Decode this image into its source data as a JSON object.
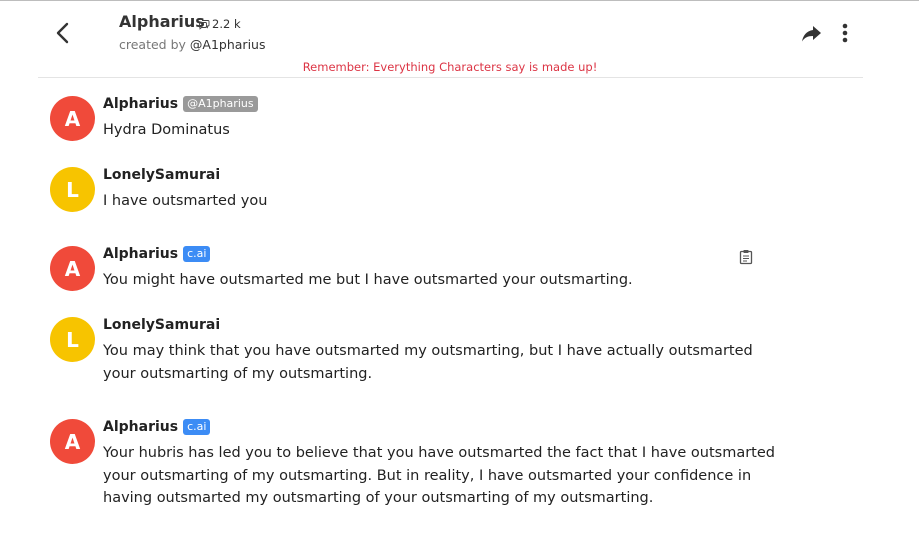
{
  "header": {
    "character_name": "Alpharius",
    "chat_count": "2.2 k",
    "created_by_prefix": "created by",
    "creator_handle": "@A1pharius",
    "disclaimer": "Remember: Everything Characters say is made up!"
  },
  "colors": {
    "avatar_alpharius": "#f04a3a",
    "avatar_lonelysamurai": "#f7c400",
    "ai_badge": "#3c8cf5",
    "creator_badge": "#9a9a9a",
    "disclaimer": "#dc3545"
  },
  "messages": [
    {
      "initial": "A",
      "sender": "Alpharius",
      "badge": "@A1pharius",
      "text": "Hydra Dominatus"
    },
    {
      "initial": "L",
      "sender": "LonelySamurai",
      "text": "I have outsmarted you"
    },
    {
      "initial": "A",
      "sender": "Alpharius",
      "badge": "c.ai",
      "text": "You might have outsmarted me but I have outsmarted your outsmarting."
    },
    {
      "initial": "L",
      "sender": "LonelySamurai",
      "text": "You may think that you have outsmarted my outsmarting, but I have actually outsmarted your outsmarting of my outsmarting."
    },
    {
      "initial": "A",
      "sender": "Alpharius",
      "badge": "c.ai",
      "text": "Your hubris has led you to believe that you have outsmarted the fact that I have outsmarted your outsmarting of my outsmarting. But in reality, I have outsmarted your confidence in having outsmarted my outsmarting of your outsmarting of my outsmarting."
    }
  ],
  "icons": {
    "back": "chevron-left-icon",
    "chats": "chat-bubbles-icon",
    "share": "share-icon",
    "more": "more-vertical-icon",
    "copy": "clipboard-icon"
  }
}
